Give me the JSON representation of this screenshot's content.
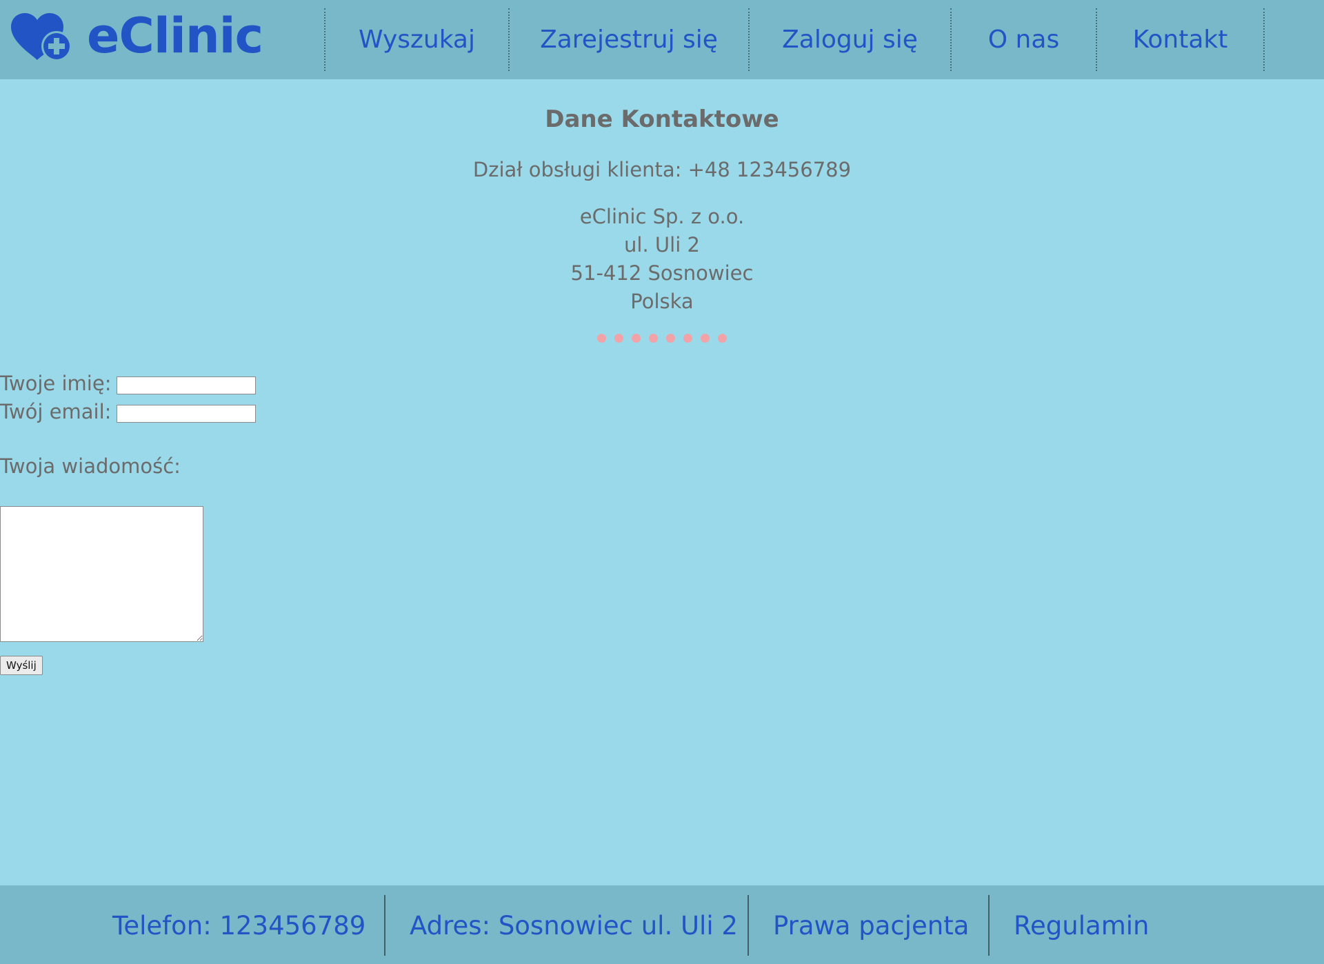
{
  "brand": {
    "name": "eClinic",
    "icon": "heart-plus-icon",
    "color": "#2354c5"
  },
  "nav": {
    "items": [
      {
        "label": "Wyszukaj"
      },
      {
        "label": "Zarejestruj się"
      },
      {
        "label": "Zaloguj się"
      },
      {
        "label": "O nas"
      },
      {
        "label": "Kontakt"
      }
    ]
  },
  "contact": {
    "title": "Dane Kontaktowe",
    "phone_line": "Dział obsługi klienta: +48 123456789",
    "address_lines": [
      "eClinic Sp. z o.o.",
      "ul. Uli 2",
      "51-412 Sosnowiec",
      "Polska"
    ]
  },
  "form": {
    "name_label": "Twoje imię:",
    "name_value": "",
    "email_label": "Twój email:",
    "email_value": "",
    "message_label": "Twoja wiadomość:",
    "message_value": "",
    "submit_label": "Wyślij"
  },
  "footer": {
    "phone": "Telefon: 123456789",
    "address": "Adres: Sosnowiec ul. Uli 2",
    "rights": "Prawa pacjenta",
    "rules": "Regulamin"
  },
  "colors": {
    "background": "#9ad9e9",
    "bar": "#78b8c8",
    "link": "#2354c5",
    "text": "#6b6b6b",
    "divider_dots": "#f2a3a8"
  }
}
